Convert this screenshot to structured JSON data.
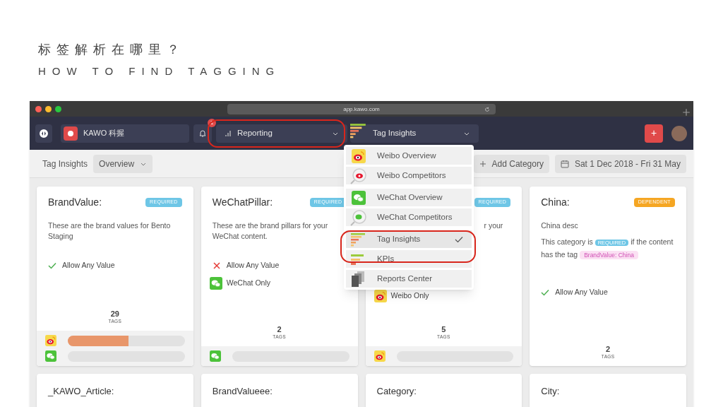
{
  "slide": {
    "title_cn": "标签解析在哪里？",
    "title_en": "HOW TO FIND TAGGING"
  },
  "browser": {
    "url": "app.kawo.com"
  },
  "toolbar": {
    "brand": "KAWO 科握",
    "notifications": "1",
    "reporting": "Reporting",
    "section": "Tag Insights",
    "add": "+"
  },
  "menu": {
    "groups": [
      [
        {
          "kind": "weibo-overview",
          "label": "Weibo Overview",
          "selected": false
        },
        {
          "kind": "weibo-competitors",
          "label": "Weibo Competitors",
          "selected": false
        }
      ],
      [
        {
          "kind": "wechat-overview",
          "label": "WeChat Overview",
          "selected": false
        },
        {
          "kind": "wechat-competitors",
          "label": "WeChat Competitors",
          "selected": false
        }
      ],
      [
        {
          "kind": "tag-insights",
          "label": "Tag Insights",
          "selected": true
        },
        {
          "kind": "kpis",
          "label": "KPIs",
          "selected": false
        },
        {
          "kind": "reports",
          "label": "Reports Center",
          "selected": false
        }
      ]
    ]
  },
  "subheader": {
    "title": "Tag Insights",
    "view": "Overview",
    "add_category": "Add Category",
    "date_range": "Sat 1 Dec 2018 - Fri 31 May"
  },
  "cards": [
    {
      "title": "BrandValue:",
      "badge": {
        "kind": "required",
        "label": "REQUIRED"
      },
      "description": "These are the brand values for Bento Staging",
      "allow_any": true,
      "allow_label": "Allow Any Value",
      "count": "29",
      "count_label": "TAGS",
      "channels": [
        {
          "kind": "weibo",
          "level": 0.52
        },
        {
          "kind": "wechat",
          "level": 0
        }
      ]
    },
    {
      "title": "WeChatPillar:",
      "badge": {
        "kind": "required",
        "label": "REQUIRED"
      },
      "description": "These are the brand pillars for your WeChat content.",
      "allow_any": false,
      "allow_label": "Allow Any Value",
      "only": {
        "kind": "wechat",
        "label": "WeChat Only"
      },
      "count": "2",
      "count_label": "TAGS",
      "channels": [
        {
          "kind": "wechat",
          "level": 0
        }
      ]
    },
    {
      "badge": {
        "kind": "required",
        "label": "REQUIRED"
      },
      "description": "r your",
      "only": {
        "kind": "weibo",
        "label": "Weibo Only"
      },
      "count": "5",
      "count_label": "TAGS",
      "channels": [
        {
          "kind": "weibo",
          "level": 0
        }
      ]
    },
    {
      "title": "China:",
      "badge": {
        "kind": "dependent",
        "label": "DEPENDENT"
      },
      "description": "China desc",
      "rule": {
        "before": "This category is",
        "badge": "REQUIRED",
        "after": "if the content has the tag",
        "tag": "BrandValue: China"
      },
      "allow_any": true,
      "allow_label": "Allow Any Value",
      "count": "2",
      "count_label": "TAGS"
    }
  ],
  "more_cards": [
    {
      "title": "_KAWO_Article:"
    },
    {
      "title": "BrandValueee:"
    },
    {
      "title": "Category:"
    },
    {
      "title": "City:"
    }
  ]
}
